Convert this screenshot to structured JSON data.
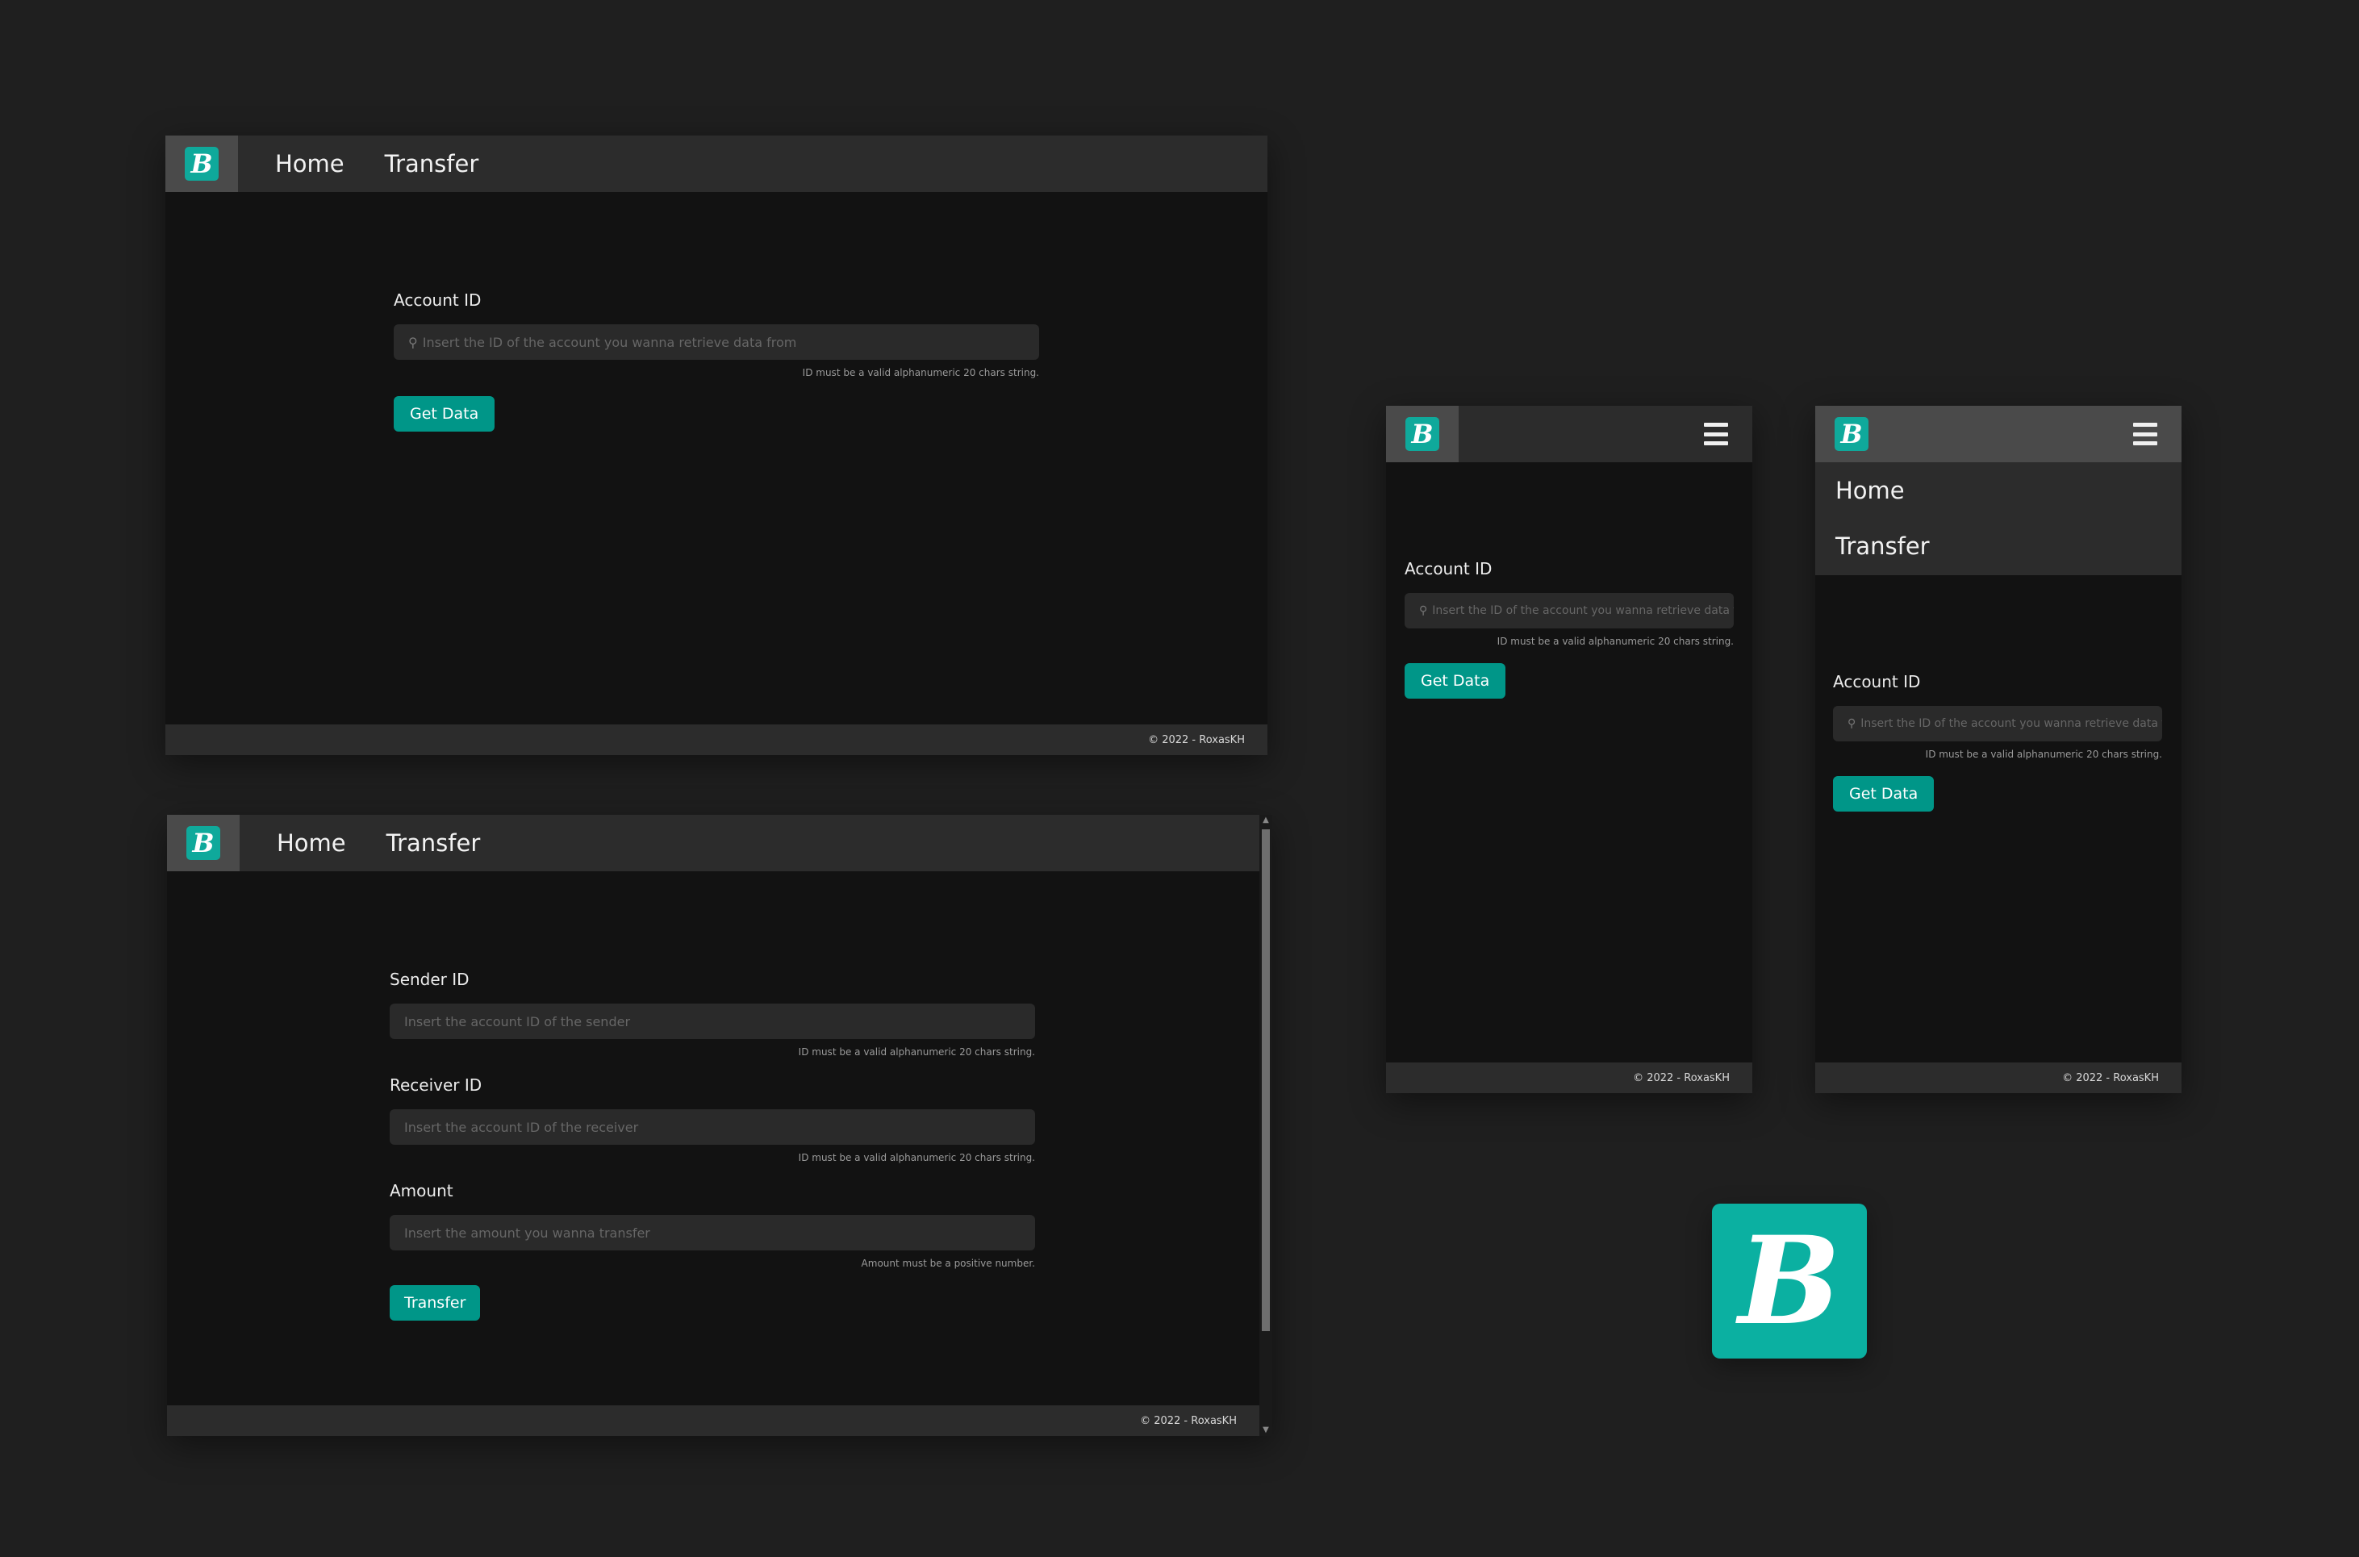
{
  "brand": {
    "logo_letter": "B",
    "accent_color": "#009688",
    "logo_color": "#0bb0a1"
  },
  "nav": {
    "home_label": "Home",
    "transfer_label": "Transfer"
  },
  "footer_text": "© 2022 - RoxasKH",
  "account_form": {
    "label": "Account ID",
    "placeholder": "Insert the ID of the account you wanna retrieve data from",
    "help": "ID must be a valid alphanumeric 20 chars string.",
    "button": "Get Data"
  },
  "mobile_account_form": {
    "placeholder": "Insert the ID of the account you wanna retrieve data fror"
  },
  "transfer_form": {
    "sender_label": "Sender ID",
    "sender_placeholder": "Insert the account ID of the sender",
    "sender_help": "ID must be a valid alphanumeric 20 chars string.",
    "receiver_label": "Receiver ID",
    "receiver_placeholder": "Insert the account ID of the receiver",
    "receiver_help": "ID must be a valid alphanumeric 20 chars string.",
    "amount_label": "Amount",
    "amount_placeholder": "Insert the amount you wanna transfer",
    "amount_help": "Amount must be a positive number.",
    "button": "Transfer"
  },
  "icons": {
    "search": "⚲",
    "scroll_up": "▲",
    "scroll_down": "▼"
  }
}
